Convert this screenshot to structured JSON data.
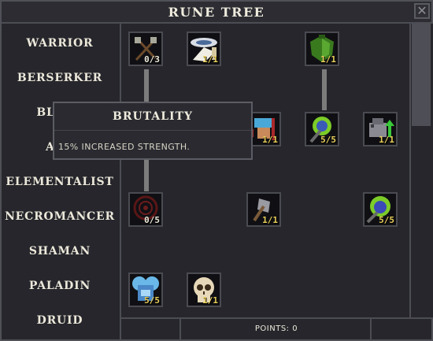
{
  "window": {
    "title": "RUNE TREE",
    "close_icon": "close-icon"
  },
  "classes": [
    "WARRIOR",
    "BERSERKER",
    "BLADE",
    "ARC",
    "ELEMENTALIST",
    "NECROMANCER",
    "SHAMAN",
    "PALADIN",
    "DRUID"
  ],
  "tree": {
    "nodes": [
      {
        "id": "crossed-axes",
        "icon": "crossed-axes-icon",
        "rank": "0/3"
      },
      {
        "id": "winged-blade",
        "icon": "winged-blade-icon",
        "rank": "1/1"
      },
      {
        "id": "green-shield",
        "icon": "green-shield-icon",
        "rank": "1/1"
      },
      {
        "id": "blue-fists",
        "icon": "blue-fists-icon",
        "rank": "1/1"
      },
      {
        "id": "spiked-club",
        "icon": "spiked-club-icon",
        "rank": "5/5"
      },
      {
        "id": "strength-up",
        "icon": "strength-up-icon",
        "rank": "1/1"
      },
      {
        "id": "red-rune",
        "icon": "red-rune-icon",
        "rank": "0/5"
      },
      {
        "id": "war-axe",
        "icon": "war-axe-icon",
        "rank": "1/1"
      },
      {
        "id": "arcane-orb",
        "icon": "arcane-orb-icon",
        "rank": "5/5"
      },
      {
        "id": "frost-helm",
        "icon": "frost-helm-icon",
        "rank": "5/5"
      },
      {
        "id": "skull",
        "icon": "skull-icon",
        "rank": "1/1"
      }
    ]
  },
  "tooltip": {
    "title": "BRUTALITY",
    "description": "15% INCREASED STRENGTH."
  },
  "footer": {
    "points_label": "POINTS: 0"
  },
  "colors": {
    "rank_full": "#e8cf5a",
    "rank_empty": "#ece8da",
    "panel": "#26262c",
    "border": "#4c4c54"
  }
}
